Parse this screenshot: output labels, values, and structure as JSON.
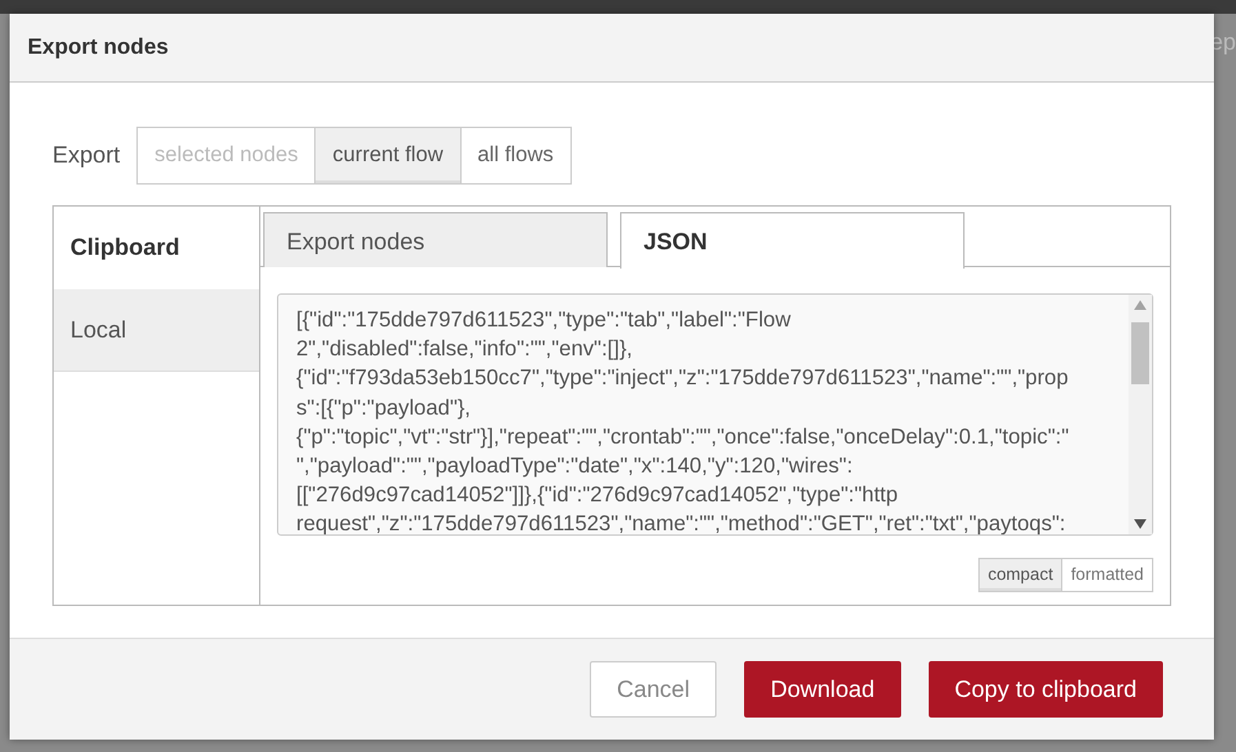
{
  "background": {
    "header_fragment": "ep"
  },
  "dialog": {
    "title": "Export nodes",
    "export_label": "Export",
    "scope_options": [
      {
        "label": "selected nodes",
        "selected": false,
        "disabled": true
      },
      {
        "label": "current flow",
        "selected": true,
        "disabled": false
      },
      {
        "label": "all flows",
        "selected": false,
        "disabled": false
      }
    ],
    "side_tabs": [
      {
        "label": "Clipboard",
        "selected": true
      },
      {
        "label": "Local",
        "selected": false
      }
    ],
    "tabs": [
      {
        "label": "Export nodes",
        "selected": false
      },
      {
        "label": "JSON",
        "selected": true
      }
    ],
    "json_lines": [
      "[{\"id\":\"175dde797d611523\",\"type\":\"tab\",\"label\":\"Flow",
      "2\",\"disabled\":false,\"info\":\"\",\"env\":[]},",
      "{\"id\":\"f793da53eb150cc7\",\"type\":\"inject\",\"z\":\"175dde797d611523\",\"name\":\"\",\"prop",
      "s\":[{\"p\":\"payload\"},",
      "{\"p\":\"topic\",\"vt\":\"str\"}],\"repeat\":\"\",\"crontab\":\"\",\"once\":false,\"onceDelay\":0.1,\"topic\":\"",
      "\",\"payload\":\"\",\"payloadType\":\"date\",\"x\":140,\"y\":120,\"wires\":",
      "[[\"276d9c97cad14052\"]]},{\"id\":\"276d9c97cad14052\",\"type\":\"http",
      "request\",\"z\":\"175dde797d611523\",\"name\":\"\",\"method\":\"GET\",\"ret\":\"txt\",\"paytoqs\":"
    ],
    "format_options": [
      {
        "label": "compact",
        "selected": true
      },
      {
        "label": "formatted",
        "selected": false
      }
    ],
    "buttons": [
      {
        "label": "Cancel",
        "kind": "secondary"
      },
      {
        "label": "Download",
        "kind": "primary"
      },
      {
        "label": "Copy to clipboard",
        "kind": "primary"
      }
    ]
  }
}
